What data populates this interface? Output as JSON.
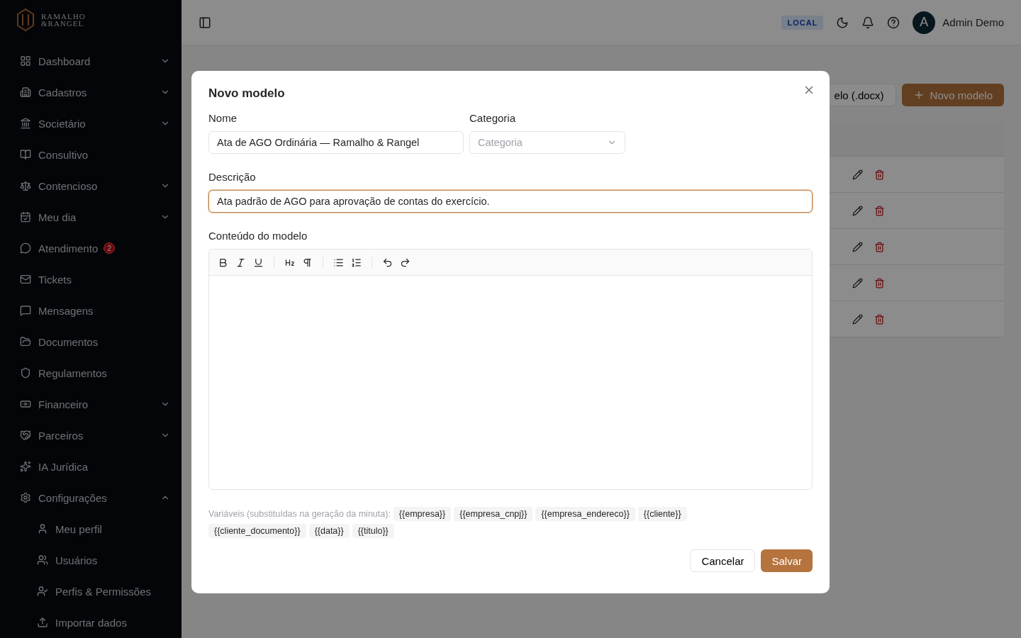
{
  "brand": {
    "line_1": "RAMALHO",
    "line_2": "&RANGEL"
  },
  "sidebar": {
    "items": [
      {
        "label": "Dashboard",
        "kind": "group",
        "expanded": false
      },
      {
        "label": "Cadastros",
        "kind": "group",
        "expanded": false
      },
      {
        "label": "Societário",
        "kind": "group",
        "expanded": false
      },
      {
        "label": "Consultivo",
        "kind": "link"
      },
      {
        "label": "Contencioso",
        "kind": "group",
        "expanded": false
      },
      {
        "label": "Meu dia",
        "kind": "group",
        "expanded": false
      },
      {
        "label": "Atendimento",
        "kind": "link",
        "badge": "2"
      },
      {
        "label": "Tickets",
        "kind": "link"
      },
      {
        "label": "Mensagens",
        "kind": "link"
      },
      {
        "label": "Documentos",
        "kind": "link"
      },
      {
        "label": "Regulamentos",
        "kind": "link"
      },
      {
        "label": "Financeiro",
        "kind": "group",
        "expanded": false
      },
      {
        "label": "Parceiros",
        "kind": "group",
        "expanded": false
      },
      {
        "label": "IA Jurídica",
        "kind": "link"
      },
      {
        "label": "Configurações",
        "kind": "group",
        "expanded": true,
        "children": [
          {
            "label": "Meu perfil"
          },
          {
            "label": "Usuários"
          },
          {
            "label": "Perfis & Permissões"
          },
          {
            "label": "Importar dados"
          }
        ]
      }
    ]
  },
  "header": {
    "environment": "LOCAL",
    "avatar": "A",
    "user": "Admin Demo"
  },
  "page_actions": {
    "upload": "elo (.docx)",
    "new": "Novo modelo"
  },
  "dialog": {
    "title": "Novo modelo",
    "name": {
      "label": "Nome",
      "value": "Ata de AGO Ordinária — Ramalho & Rangel"
    },
    "category": {
      "label": "Categoria",
      "placeholder": "Categoria"
    },
    "description": {
      "label": "Descrição",
      "value": "Ata padrão de AGO para aprovação de contas do exercício.",
      "focused": true
    },
    "content": {
      "label": "Conteúdo do modelo"
    },
    "variables_label": "Variáveis (substituídas na geração da minuta):",
    "variables": [
      "{{empresa}}",
      "{{empresa_cnpj}}",
      "{{empresa_endereco}}",
      "{{cliente}}",
      "{{cliente_documento}}",
      "{{data}}",
      "{{titulo}}"
    ],
    "buttons": {
      "cancel": "Cancelar",
      "save": "Salvar"
    }
  }
}
